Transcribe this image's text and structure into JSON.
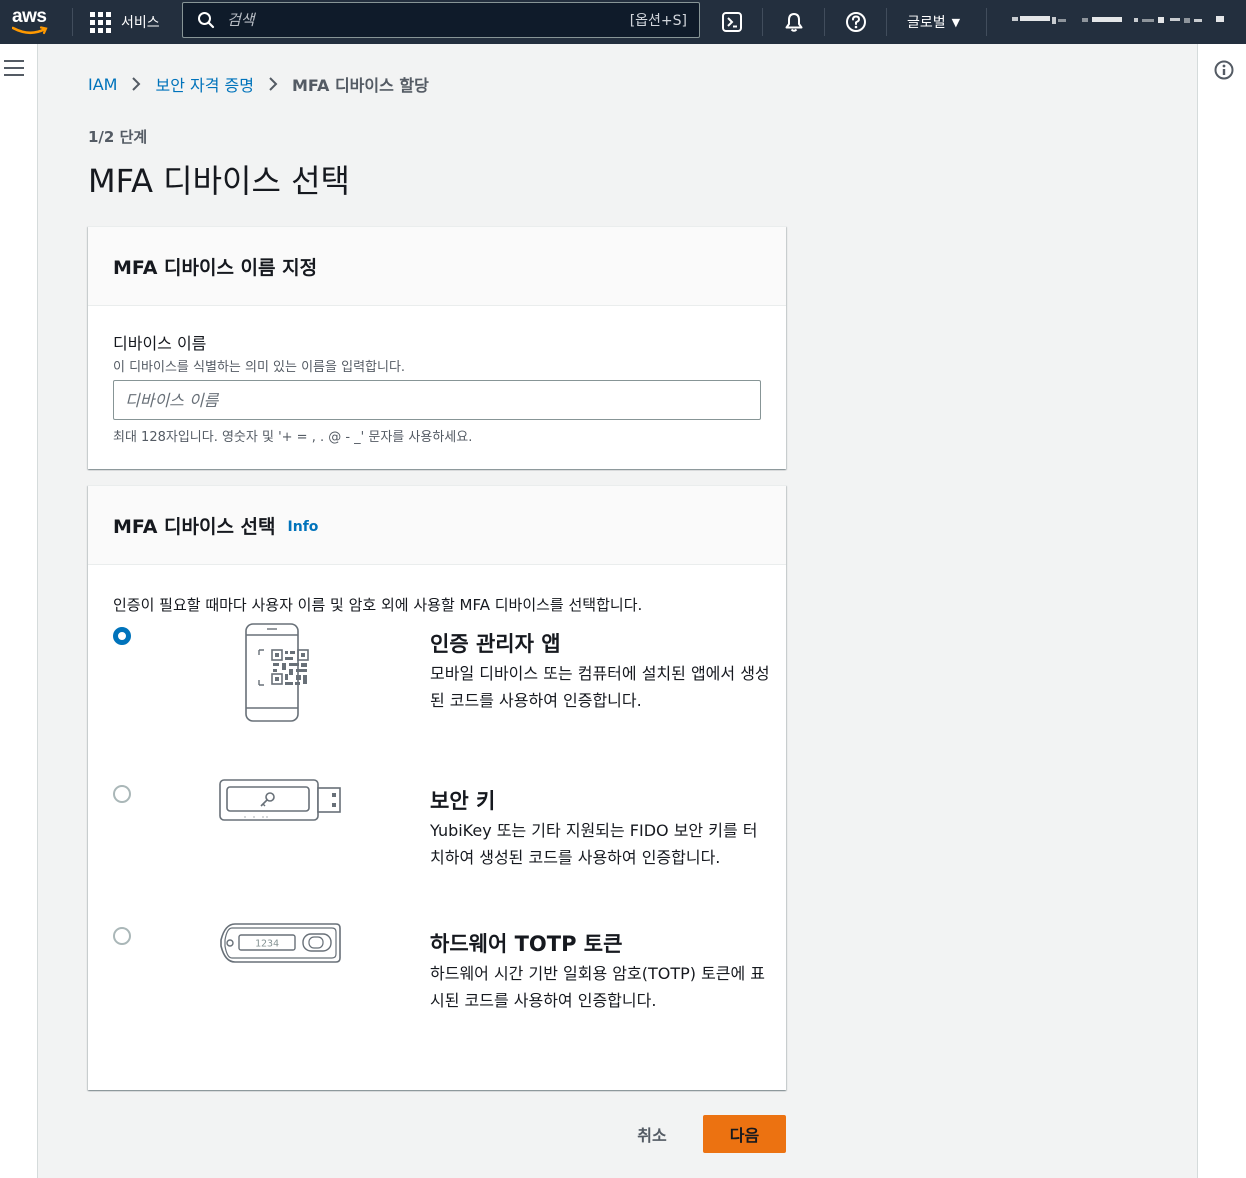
{
  "topnav": {
    "logo": "aws",
    "services_label": "서비스",
    "search_placeholder": "검색",
    "search_shortcut": "[옵션+S]",
    "region_label": "글로벌",
    "icons": [
      "cloudshell-icon",
      "bell-icon",
      "help-icon"
    ]
  },
  "breadcrumb": {
    "items": [
      "IAM",
      "보안 자격 증명"
    ],
    "current": "MFA 디바이스 할당"
  },
  "header": {
    "step": "1/2 단계",
    "title": "MFA 디바이스 선택"
  },
  "name_panel": {
    "title": "MFA 디바이스 이름 지정",
    "field_label": "디바이스 이름",
    "field_description": "이 디바이스를 식별하는 의미 있는 이름을 입력합니다.",
    "input_value": "",
    "input_placeholder": "디바이스 이름",
    "constraint": "최대 128자입니다. 영숫자 및 '+ = , . @ - _' 문자를 사용하세요."
  },
  "device_panel": {
    "title": "MFA 디바이스 선택",
    "info_link": "Info",
    "intro": "인증이 필요할 때마다 사용자 이름 및 암호 외에 사용할 MFA 디바이스를 선택합니다.",
    "selected_option": "authenticator-app",
    "options": [
      {
        "title": "인증 관리자 앱",
        "description": "모바일 디바이스 또는 컴퓨터에 설치된 앱에서 생성된 코드를 사용하여 인증합니다."
      },
      {
        "title": "보안 키",
        "description": "YubiKey 또는 기타 지원되는 FIDO 보안 키를 터치하여 생성된 코드를 사용하여 인증합니다."
      },
      {
        "title": "하드웨어 TOTP 토큰",
        "description": "하드웨어 시간 기반 일회용 암호(TOTP) 토큰에 표시된 코드를 사용하여 인증합니다.",
        "token_display": "1234"
      }
    ]
  },
  "footer": {
    "cancel_label": "취소",
    "next_label": "다음"
  },
  "colors": {
    "nav_bg": "#232f3e",
    "link": "#0073bb",
    "primary_button": "#ec7211"
  }
}
